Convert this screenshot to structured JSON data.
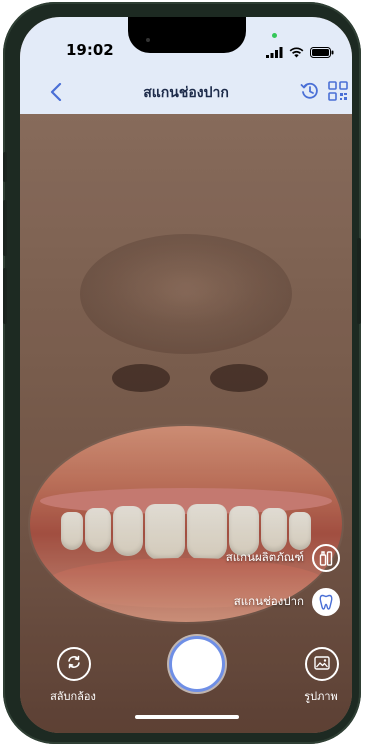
{
  "status": {
    "time": "19:02"
  },
  "header": {
    "title": "สแกนช่องปาก"
  },
  "scan_options": [
    {
      "label": "สแกนผลิตภัณฑ์",
      "icon": "product-icon",
      "active": false
    },
    {
      "label": "สแกนช่องปาก",
      "icon": "tooth-icon",
      "active": true
    }
  ],
  "bottom": {
    "switch_label": "สลับกล้อง",
    "gallery_label": "รูปภาพ"
  },
  "colors": {
    "header_bg": "#e3ebf8",
    "accent": "#4a6fd6",
    "shutter_ring": "#6f8fe6"
  }
}
